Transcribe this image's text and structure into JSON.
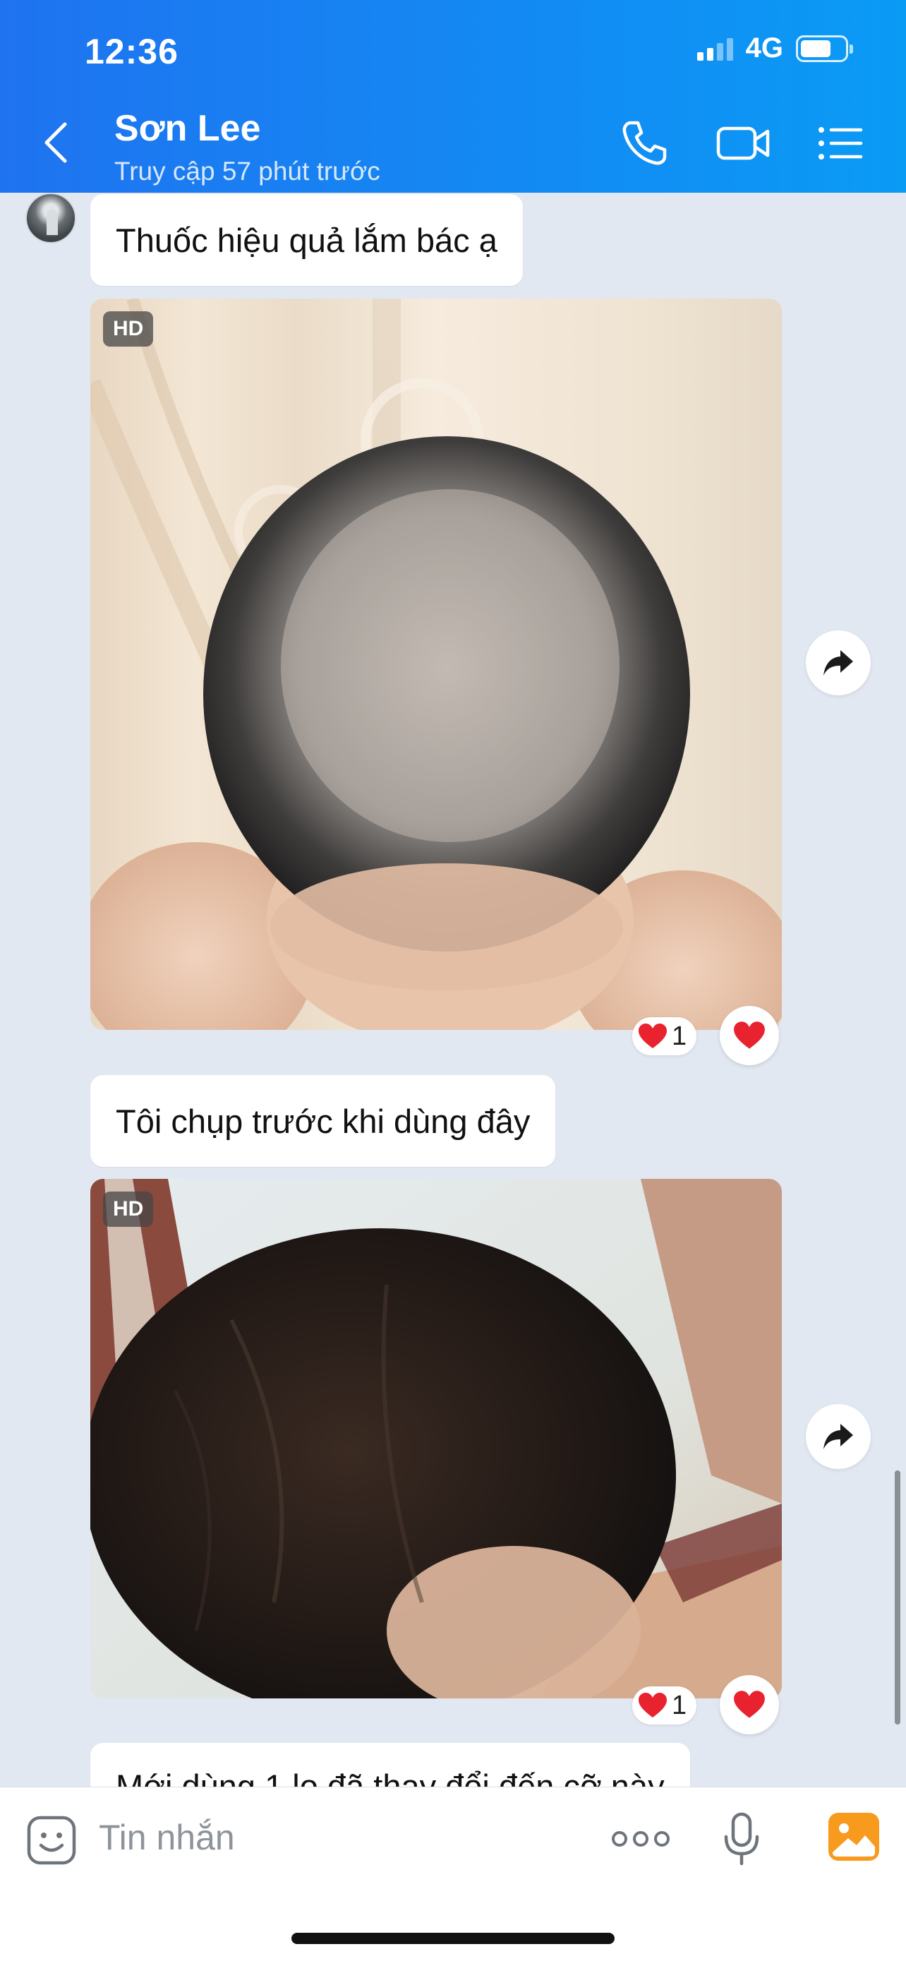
{
  "status_bar": {
    "time": "12:36",
    "network": "4G",
    "battery_level": 0.7
  },
  "header": {
    "name": "Sơn Lee",
    "status": "Truy cập 57 phút trước",
    "icons": [
      "back-chevron-icon",
      "phone-icon",
      "video-call-icon",
      "list-menu-icon"
    ]
  },
  "messages": [
    {
      "type": "text",
      "text": "Thuốc hiệu quả lắm bác ạ"
    },
    {
      "type": "image",
      "badge": "HD",
      "reaction_count": "1",
      "description_icon": "heart"
    },
    {
      "type": "text",
      "text": "Tôi chụp trước khi dùng đây"
    },
    {
      "type": "image",
      "badge": "HD",
      "reaction_count": "1",
      "description_icon": "heart"
    },
    {
      "type": "text",
      "text": "Mới dùng 1 lọ đã thay đổi đến cỡ này"
    }
  ],
  "input": {
    "placeholder": "Tin nhắn"
  },
  "colors": {
    "header_start": "#1f73f0",
    "header_end": "#0a9bf5",
    "chat_bg": "#e2e8f1",
    "heart": "#e8232f",
    "image_button": "#f79a1e"
  }
}
